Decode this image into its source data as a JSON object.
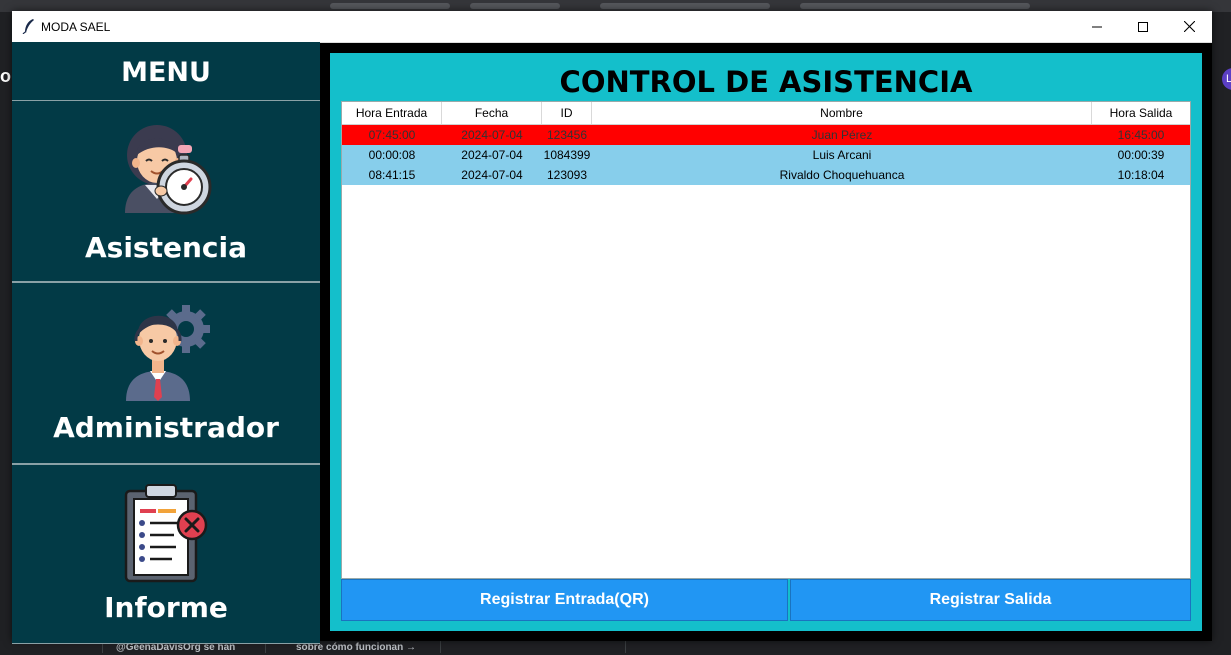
{
  "window": {
    "title": "MODA SAEL"
  },
  "sidebar": {
    "heading": "MENU",
    "items": [
      {
        "label": "Asistencia",
        "icon": "clock-person-icon"
      },
      {
        "label": "Administrador",
        "icon": "admin-gear-icon"
      },
      {
        "label": "Informe",
        "icon": "clipboard-report-icon"
      }
    ]
  },
  "main": {
    "title": "CONTROL DE ASISTENCIA",
    "columns": [
      "Hora Entrada",
      "Fecha",
      "ID",
      "Nombre",
      "Hora Salida"
    ],
    "rows": [
      {
        "hora_entrada": "07:45:00",
        "fecha": "2024-07-04",
        "id": "123456",
        "nombre": "Juan Pérez",
        "hora_salida": "16:45:00",
        "highlight": "red"
      },
      {
        "hora_entrada": "00:00:08",
        "fecha": "2024-07-04",
        "id": "1084399",
        "nombre": "Luis Arcani",
        "hora_salida": "00:00:39",
        "highlight": "blue"
      },
      {
        "hora_entrada": "08:41:15",
        "fecha": "2024-07-04",
        "id": "123093",
        "nombre": "Rivaldo Choquehuanca",
        "hora_salida": "10:18:04",
        "highlight": "blue"
      }
    ],
    "buttons": {
      "entrada": "Registrar Entrada(QR)",
      "salida": "Registrar Salida"
    }
  },
  "background": {
    "left_glyph": "o",
    "avatar_letter": "L",
    "bottom_text_1": "@GeenaDavisOrg se han",
    "bottom_text_2": "sobre cómo funcionan →"
  },
  "colors": {
    "sidebar": "#023a46",
    "panel": "#14bfcb",
    "row_highlight": "#ff0000",
    "row_normal": "#87ceeb",
    "button": "#2196f3"
  }
}
